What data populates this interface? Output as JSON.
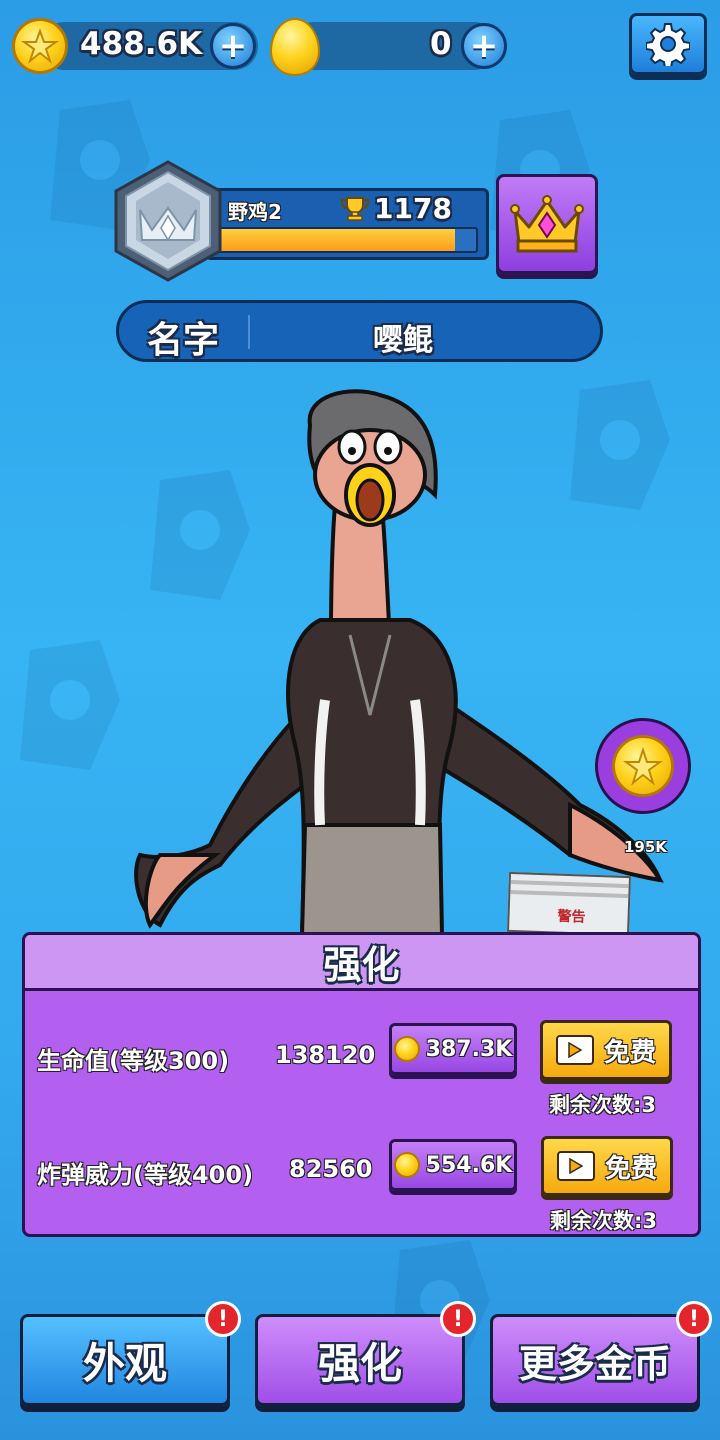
{
  "currency": {
    "coins": "488.6K",
    "gems": "0"
  },
  "player": {
    "rank_name": "野鸡2",
    "trophies": "1178",
    "progress": 0.92,
    "name_label": "名字",
    "name_value": "嘤鲲"
  },
  "reward": {
    "amount": "195K"
  },
  "prop_sign": "警告",
  "upgrade_panel": {
    "title": "强化",
    "rows": [
      {
        "label": "生命值(等级300)",
        "value": "138120",
        "cost": "387.3K",
        "free_label": "免费",
        "remaining": "剩余次数:3"
      },
      {
        "label": "炸弹威力(等级400)",
        "value": "82560",
        "cost": "554.6K",
        "free_label": "免费",
        "remaining": "剩余次数:3"
      }
    ]
  },
  "nav": {
    "appearance": "外观",
    "upgrade": "强化",
    "more_coins": "更多金币",
    "badge": "!"
  },
  "colors": {
    "background": "#33a8ee",
    "panel_purple": "#b35ff0",
    "button_gold": "#ffd84a",
    "alert_red": "#e4262c"
  },
  "icons": [
    "star-coin-icon",
    "gold-egg-icon",
    "plus-icon",
    "gear-icon",
    "rank-emblem-icon",
    "trophy-icon",
    "crown-icon",
    "video-play-icon",
    "alert-icon"
  ]
}
